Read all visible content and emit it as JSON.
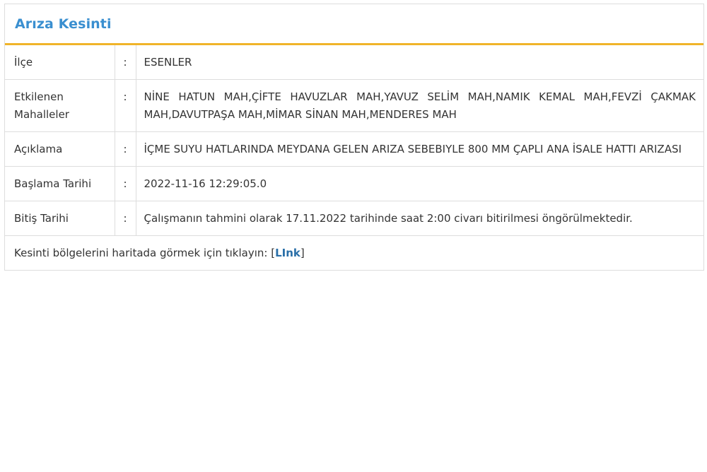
{
  "panel": {
    "title": "Arıza Kesinti"
  },
  "rows": [
    {
      "label": "İlçe",
      "separator": ":",
      "value": "ESENLER"
    },
    {
      "label": "Etkilenen Mahalleler",
      "separator": ":",
      "value": "NİNE HATUN MAH,ÇİFTE HAVUZLAR MAH,YAVUZ SELİM MAH,NAMIK KEMAL MAH,FEVZİ ÇAKMAK MAH,DAVUTPAŞA MAH,MİMAR SİNAN MAH,MENDERES MAH"
    },
    {
      "label": "Açıklama",
      "separator": ":",
      "value": "İÇME SUYU HATLARINDA MEYDANA GELEN ARIZA SEBEBIYLE 800 MM ÇAPLI ANA İSALE HATTI ARIZASI"
    },
    {
      "label": "Başlama Tarihi",
      "separator": ":",
      "value": "2022-11-16 12:29:05.0"
    },
    {
      "label": "Bitiş Tarihi",
      "separator": ":",
      "value": "Çalışmanın tahmini olarak 17.11.2022 tarihinde saat 2:00 civarı bitirilmesi öngörülmektedir."
    }
  ],
  "footer": {
    "text": "Kesinti bölgelerini haritada görmek için tıklayın: ",
    "bracket_open": "[",
    "link_label": "LInk",
    "bracket_close": "]"
  },
  "colors": {
    "title": "#3a8fd0",
    "header_underline": "#f0b429",
    "link": "#2a6fa8",
    "border": "#dddddd"
  }
}
